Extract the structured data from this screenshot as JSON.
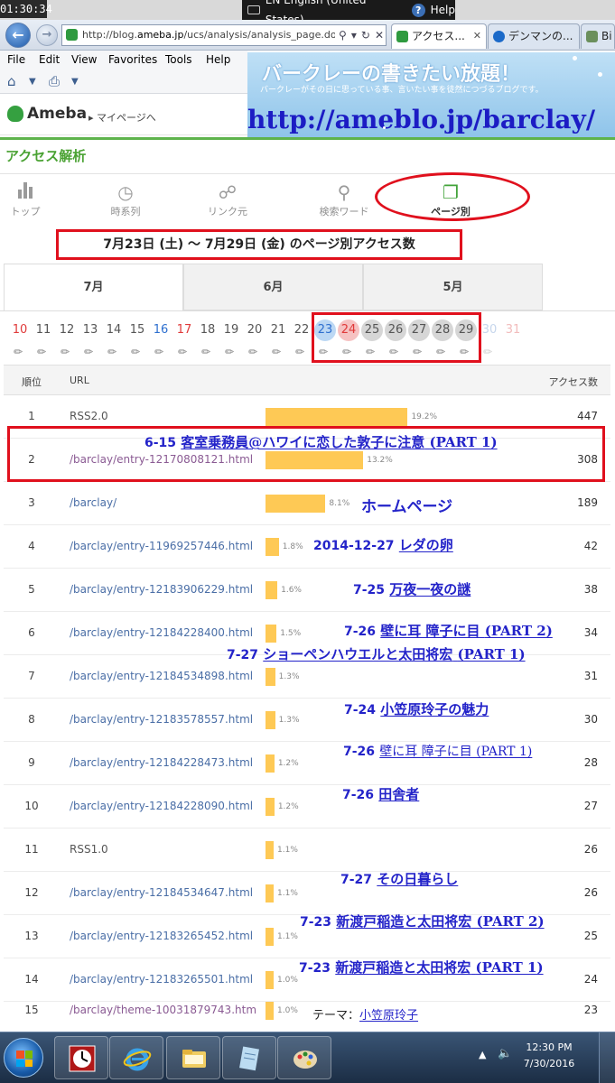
{
  "system": {
    "top_clock": "01:30:34",
    "language": "EN English (United States)",
    "help": "Help"
  },
  "browser": {
    "address": {
      "scheme": "http://blog.",
      "host": "ameba.jp",
      "path": "/ucs/analysis/analysis_page.do"
    },
    "tabs": [
      {
        "label": "アクセス...",
        "close": "✕"
      },
      {
        "label": "デンマンの..."
      },
      {
        "label": "Bi"
      }
    ],
    "menu": [
      "File",
      "Edit",
      "View",
      "Favorites",
      "Tools",
      "Help"
    ]
  },
  "ameba": {
    "logo": "Ameba",
    "mypage": "▸ マイページへ"
  },
  "banner": {
    "title": "バークレーの書きたい放題！",
    "subtitle": "バークレーがその日に思っている事、言いたい事を徒然につづるブログです。",
    "url": "http://ameblo.jp/barclay/"
  },
  "page": {
    "heading": "アクセス解析"
  },
  "nav": [
    {
      "label": "トップ",
      "icon": "bar-chart-icon"
    },
    {
      "label": "時系列",
      "icon": "clock-icon"
    },
    {
      "label": "リンク元",
      "icon": "link-icon"
    },
    {
      "label": "検索ワード",
      "icon": "search-icon"
    },
    {
      "label": "ページ別",
      "icon": "pages-icon"
    }
  ],
  "date_range": "7月23日 (土) ～ 7月29日 (金) のページ別アクセス数",
  "months": [
    "7月",
    "6月",
    "5月"
  ],
  "days": [
    "10",
    "11",
    "12",
    "13",
    "14",
    "15",
    "16",
    "17",
    "18",
    "19",
    "20",
    "21",
    "22",
    "23",
    "24",
    "25",
    "26",
    "27",
    "28",
    "29",
    "30",
    "31"
  ],
  "table": {
    "headers": {
      "rank": "順位",
      "url": "URL",
      "count": "アクセス数"
    },
    "rows": [
      {
        "rank": "1",
        "url": "RSS2.0",
        "pct": "19.2%",
        "share": 19.2,
        "count": "447"
      },
      {
        "rank": "2",
        "url": "/barclay/entry-12170808121.html",
        "pct": "13.2%",
        "share": 13.2,
        "count": "308"
      },
      {
        "rank": "3",
        "url": "/barclay/",
        "pct": "8.1%",
        "share": 8.1,
        "count": "189"
      },
      {
        "rank": "4",
        "url": "/barclay/entry-11969257446.html",
        "pct": "1.8%",
        "share": 1.8,
        "count": "42"
      },
      {
        "rank": "5",
        "url": "/barclay/entry-12183906229.html",
        "pct": "1.6%",
        "share": 1.6,
        "count": "38"
      },
      {
        "rank": "6",
        "url": "/barclay/entry-12184228400.html",
        "pct": "1.5%",
        "share": 1.5,
        "count": "34"
      },
      {
        "rank": "7",
        "url": "/barclay/entry-12184534898.html",
        "pct": "1.3%",
        "share": 1.3,
        "count": "31"
      },
      {
        "rank": "8",
        "url": "/barclay/entry-12183578557.html",
        "pct": "1.3%",
        "share": 1.3,
        "count": "30"
      },
      {
        "rank": "9",
        "url": "/barclay/entry-12184228473.html",
        "pct": "1.2%",
        "share": 1.2,
        "count": "28"
      },
      {
        "rank": "10",
        "url": "/barclay/entry-12184228090.html",
        "pct": "1.2%",
        "share": 1.2,
        "count": "27"
      },
      {
        "rank": "11",
        "url": "RSS1.0",
        "pct": "1.1%",
        "share": 1.1,
        "count": "26"
      },
      {
        "rank": "12",
        "url": "/barclay/entry-12184534647.html",
        "pct": "1.1%",
        "share": 1.1,
        "count": "26"
      },
      {
        "rank": "13",
        "url": "/barclay/entry-12183265452.html",
        "pct": "1.1%",
        "share": 1.1,
        "count": "25"
      },
      {
        "rank": "14",
        "url": "/barclay/entry-12183265501.html",
        "pct": "1.0%",
        "share": 1.0,
        "count": "24"
      },
      {
        "rank": "15",
        "url": "/barclay/theme-10031879743.htm",
        "pct": "1.0%",
        "share": 1.0,
        "count": "23"
      }
    ]
  },
  "annotations": {
    "a2": {
      "date": "6-15",
      "title": "客室乗務員@ハワイに恋した敦子に注意",
      "part": "(PART 1)"
    },
    "a3": {
      "title": "ホームページ"
    },
    "a4": {
      "date": "2014-12-27",
      "title": "レダの卵"
    },
    "a5": {
      "date": "7-25",
      "title": "万夜一夜の謎"
    },
    "a6": {
      "date": "7-26",
      "title": "壁に耳 障子に目",
      "part": "(PART 2)"
    },
    "a7": {
      "date": "7-27",
      "title": "ショーペンハウエルと太田将宏",
      "part": "(PART 1)"
    },
    "a8": {
      "date": "7-24",
      "title": "小笠原玲子の魅力"
    },
    "a9": {
      "date": "7-26",
      "title": "壁に耳 障子に目 (PART 1)"
    },
    "a10": {
      "date": "7-26",
      "title": "田舎者"
    },
    "a12": {
      "date": "7-27",
      "title": "その日暮らし"
    },
    "a13": {
      "date": "7-23",
      "title": "新渡戸稲造と太田将宏",
      "part": "(PART 2)"
    },
    "a14": {
      "date": "7-23",
      "title": "新渡戸稲造と太田将宏",
      "part": "(PART 1)"
    },
    "a15": {
      "prefix": "テーマ：",
      "title": "小笠原玲子"
    }
  },
  "taskbar": {
    "time": "12:30 PM",
    "date": "7/30/2016"
  },
  "colors": {
    "accent_green": "#4aa233",
    "highlight_red": "#e0101d",
    "bar_yellow": "#fec955",
    "annotation_blue": "#2323c9"
  }
}
